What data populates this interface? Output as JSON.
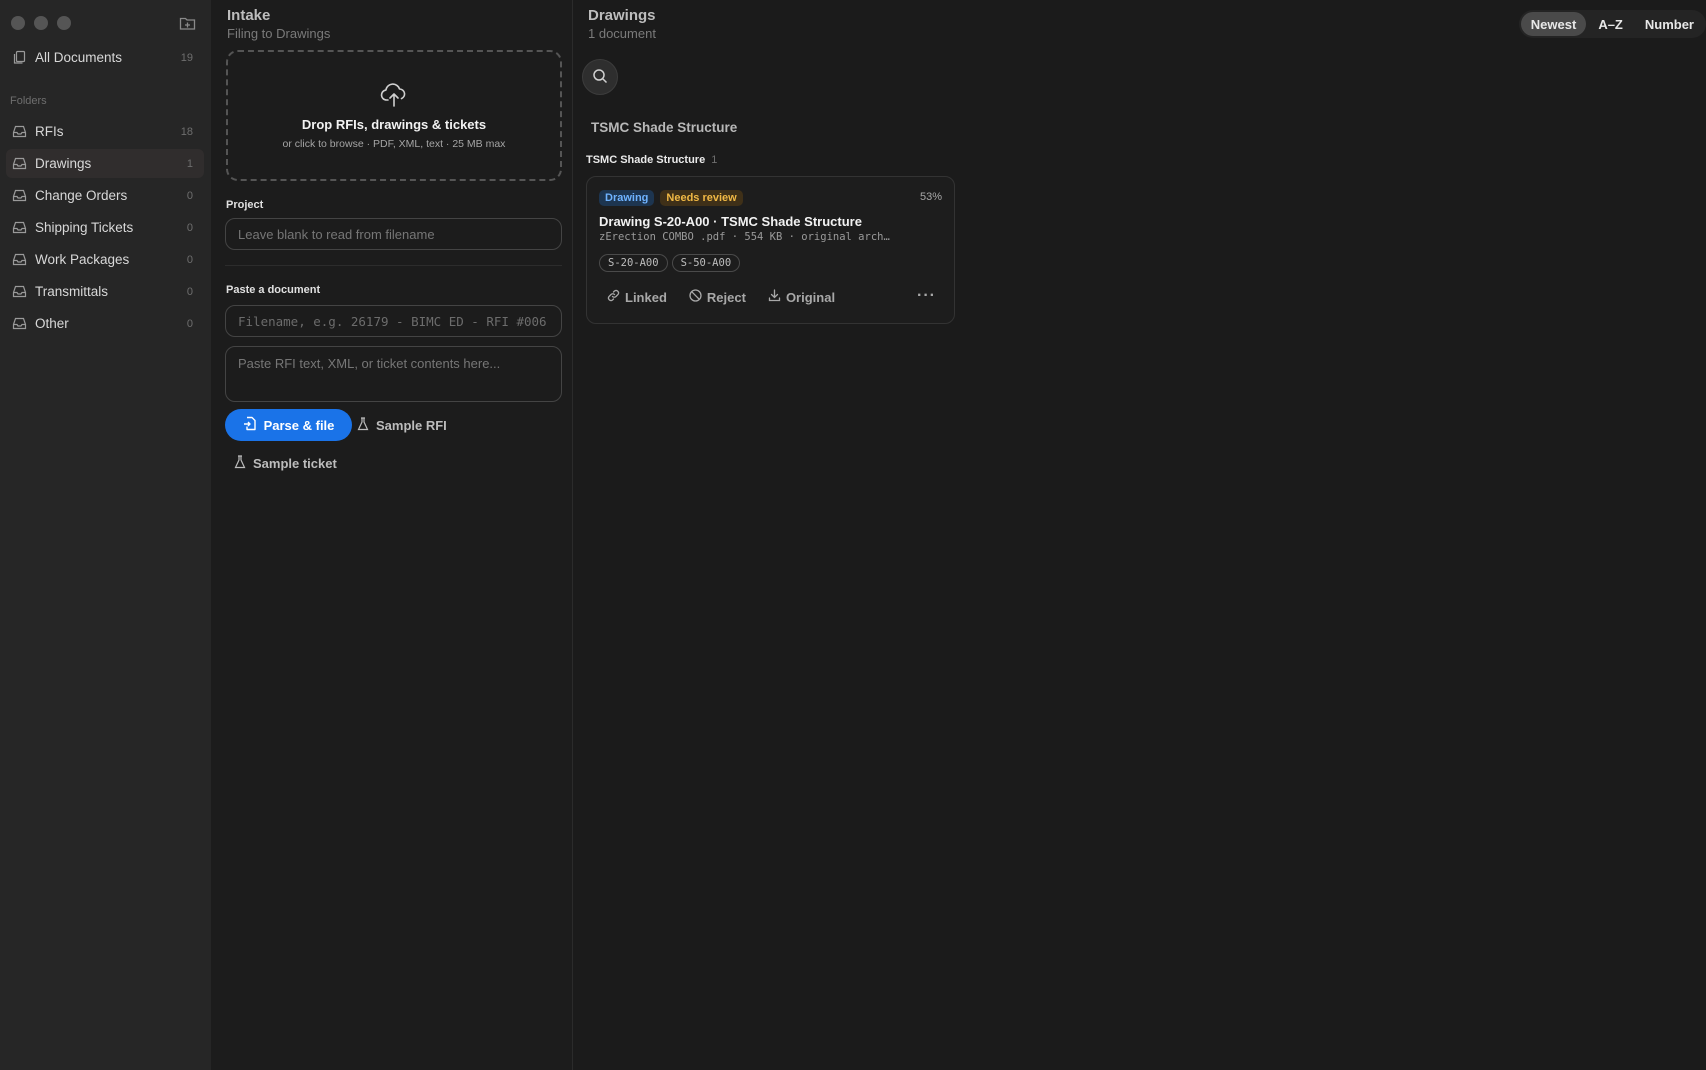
{
  "sidebar": {
    "all_documents": {
      "label": "All Documents",
      "count": "19"
    },
    "folders_heading": "Folders",
    "items": [
      {
        "label": "RFIs",
        "count": "18"
      },
      {
        "label": "Drawings",
        "count": "1"
      },
      {
        "label": "Change Orders",
        "count": "0"
      },
      {
        "label": "Shipping Tickets",
        "count": "0"
      },
      {
        "label": "Work Packages",
        "count": "0"
      },
      {
        "label": "Transmittals",
        "count": "0"
      },
      {
        "label": "Other",
        "count": "0"
      }
    ]
  },
  "intake": {
    "title": "Intake",
    "subtitle": "Filing to Drawings",
    "dropzone": {
      "title": "Drop RFIs, drawings & tickets",
      "subtitle": "or click to browse · PDF, XML, text · 25 MB max"
    },
    "project": {
      "label": "Project",
      "placeholder": "Leave blank to read from filename"
    },
    "paste": {
      "label": "Paste a document",
      "filename_placeholder": "Filename, e.g. 26179 - BIMC ED - RFI #006",
      "content_placeholder": "Paste RFI text, XML, or ticket contents here..."
    },
    "buttons": {
      "parse": "Parse & file",
      "sample_rfi": "Sample RFI",
      "sample_ticket": "Sample ticket"
    }
  },
  "main": {
    "title": "Drawings",
    "subtitle": "1 document",
    "sort": {
      "newest": "Newest",
      "az": "A–Z",
      "number": "Number"
    },
    "group_title": "TSMC Shade Structure",
    "subgroup": {
      "label": "TSMC Shade Structure",
      "count": "1"
    },
    "card": {
      "type_tag": "Drawing",
      "status_tag": "Needs review",
      "percent": "53%",
      "title": "Drawing S-20-A00 · TSMC Shade Structure",
      "meta": "zErection COMBO .pdf · 554 KB · original arch…",
      "chips": [
        "S-20-A00",
        "S-50-A00"
      ],
      "actions": {
        "linked": "Linked",
        "reject": "Reject",
        "original": "Original"
      }
    }
  },
  "colors": {
    "accent": "#1a73e8",
    "tag_blue": "#6fb3ff",
    "tag_amber": "#f0b845"
  }
}
